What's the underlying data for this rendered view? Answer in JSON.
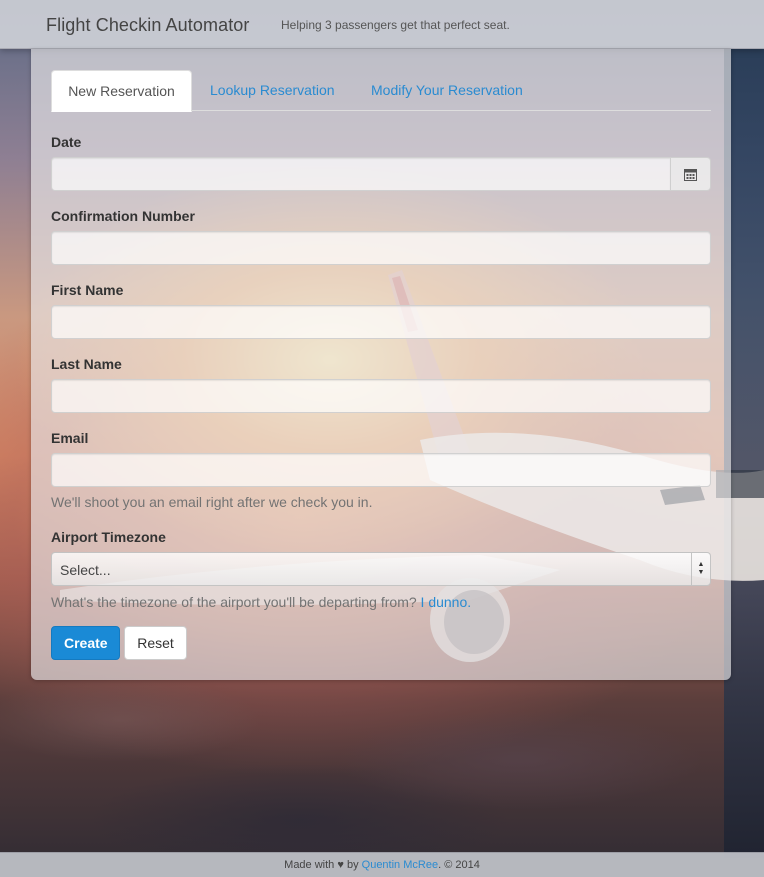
{
  "header": {
    "brand": "Flight Checkin Automator",
    "tagline": "Helping 3 passengers get that perfect seat."
  },
  "tabs": [
    {
      "label": "New Reservation",
      "active": true
    },
    {
      "label": "Lookup Reservation",
      "active": false
    },
    {
      "label": "Modify Your Reservation",
      "active": false
    }
  ],
  "form": {
    "date": {
      "label": "Date",
      "value": "",
      "icon": "calendar-icon"
    },
    "confirmation": {
      "label": "Confirmation Number",
      "value": ""
    },
    "first_name": {
      "label": "First Name",
      "value": ""
    },
    "last_name": {
      "label": "Last Name",
      "value": ""
    },
    "email": {
      "label": "Email",
      "value": "",
      "help": "We'll shoot you an email right after we check you in."
    },
    "timezone": {
      "label": "Airport Timezone",
      "selected": "Select...",
      "help": "What's the timezone of the airport you'll be departing from?",
      "help_link": "I dunno."
    },
    "buttons": {
      "create": "Create",
      "reset": "Reset"
    }
  },
  "footer": {
    "prefix": "Made with",
    "heart": "♥",
    "by": "by",
    "author": "Quentin McRee",
    "suffix": ". © 2014"
  },
  "colors": {
    "accent": "#2a8bd1",
    "primary_button": "#1a8ad6"
  }
}
